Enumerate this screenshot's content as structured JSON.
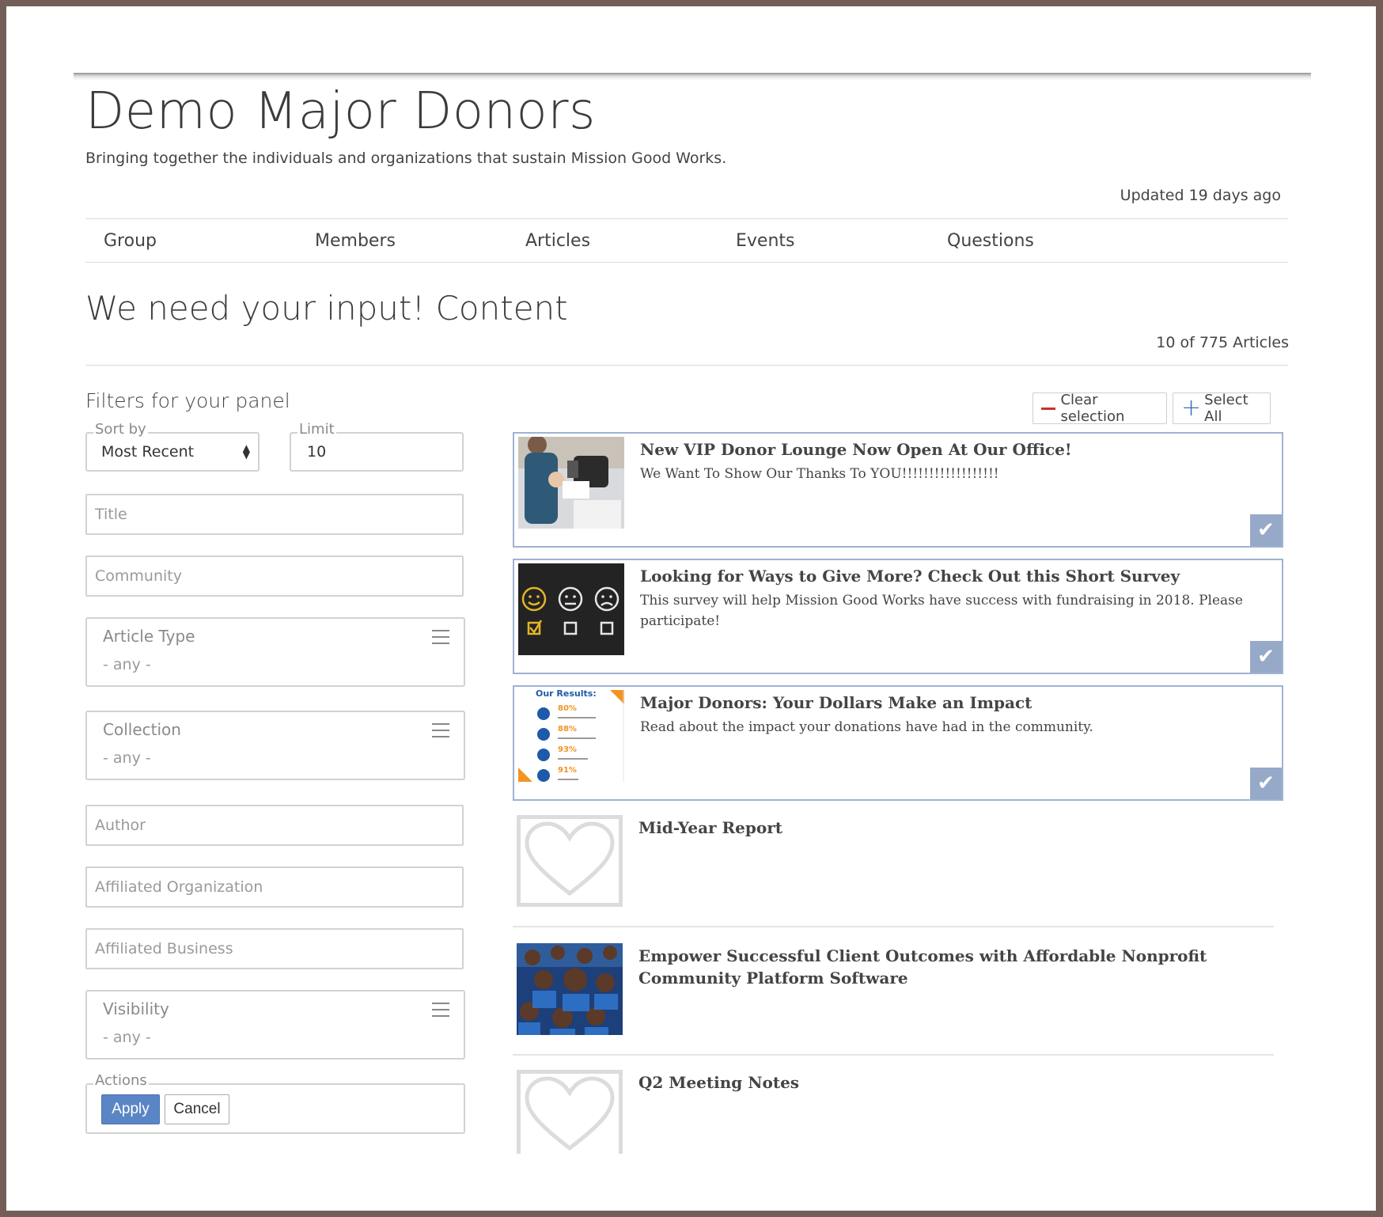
{
  "header": {
    "title": "Demo Major Donors",
    "subtitle": "Bringing together the individuals and organizations that sustain Mission Good Works.",
    "updated": "Updated 19 days ago"
  },
  "tabs": [
    "Group",
    "Members",
    "Articles",
    "Events",
    "Questions"
  ],
  "section": {
    "title": "We need your input! Content",
    "count": "10 of 775 Articles"
  },
  "filters": {
    "title": "Filters for your panel",
    "sort_label": "Sort by",
    "sort_value": "Most Recent",
    "limit_label": "Limit",
    "limit_value": "10",
    "title_placeholder": "Title",
    "community_placeholder": "Community",
    "article_type_label": "Article Type",
    "collection_label": "Collection",
    "any": "- any -",
    "author_placeholder": "Author",
    "affiliated_org_placeholder": "Affiliated Organization",
    "affiliated_business_placeholder": "Affiliated Business",
    "visibility_label": "Visibility",
    "actions_label": "Actions",
    "apply": "Apply",
    "cancel": "Cancel"
  },
  "toolbar": {
    "clear_selection": "Clear selection",
    "select_all": "Select All"
  },
  "articles": [
    {
      "title": "New VIP Donor Lounge Now Open At Our Office!",
      "desc": "We Want To Show Our Thanks To YOU!!!!!!!!!!!!!!!!!!",
      "selected": true
    },
    {
      "title": "Looking for Ways to Give More? Check Out this Short Survey",
      "desc": "This survey will help Mission Good Works have success with fundraising in 2018. Please participate!",
      "selected": true
    },
    {
      "title": "Major Donors: Your Dollars Make an Impact",
      "desc": "Read about the impact your donations have had in the community.",
      "selected": true
    },
    {
      "title": "Mid-Year Report",
      "desc": "",
      "selected": false
    },
    {
      "title": "Empower Successful Client Outcomes with Affordable Nonprofit Community Platform Software",
      "desc": "",
      "selected": false
    },
    {
      "title": "Q2 Meeting Notes",
      "desc": "",
      "selected": false
    }
  ],
  "impact_thumb": {
    "heading": "Our Results:",
    "stats": [
      "80%",
      "88%",
      "93%",
      "91%"
    ]
  },
  "colors": {
    "accent": "#5b86c5",
    "check_bg": "#97a9c9",
    "selected_border": "#9fb3d3",
    "danger": "#c9302c",
    "frame": "#735f58"
  }
}
